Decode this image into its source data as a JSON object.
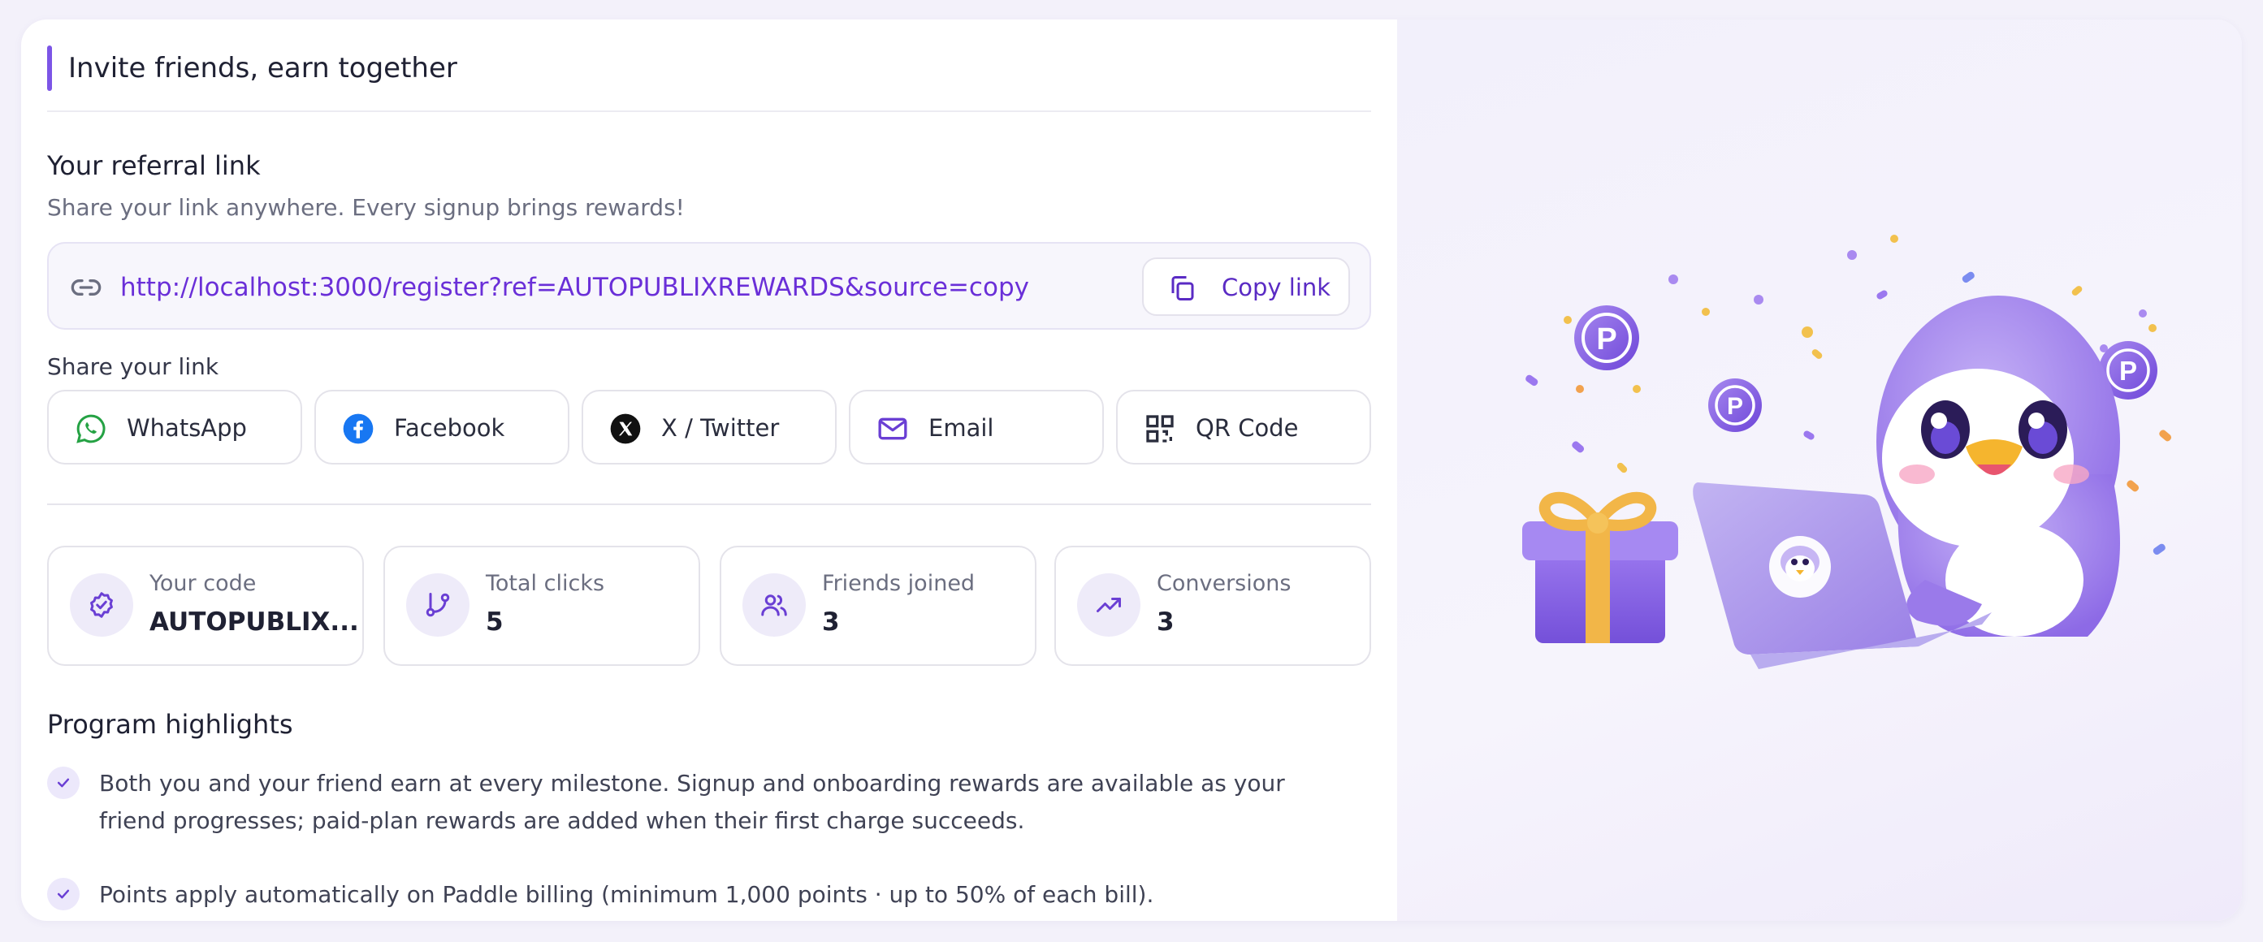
{
  "header": {
    "title": "Invite friends, earn together"
  },
  "referral": {
    "title": "Your referral link",
    "subtitle": "Share your link anywhere. Every signup brings rewards!",
    "link": "http://localhost:3000/register?ref=AUTOPUBLIXREWARDS&source=copy",
    "copy_label": "Copy link"
  },
  "share": {
    "label": "Share your link",
    "buttons": [
      {
        "label": "WhatsApp",
        "icon": "whatsapp-icon"
      },
      {
        "label": "Facebook",
        "icon": "facebook-icon"
      },
      {
        "label": "X / Twitter",
        "icon": "x-twitter-icon"
      },
      {
        "label": "Email",
        "icon": "mail-icon"
      },
      {
        "label": "QR Code",
        "icon": "qr-code-icon"
      }
    ]
  },
  "stats": [
    {
      "label": "Your code",
      "value": "AUTOPUBLIX...",
      "icon": "badge-check-icon"
    },
    {
      "label": "Total clicks",
      "value": "5",
      "icon": "git-branch-icon"
    },
    {
      "label": "Friends joined",
      "value": "3",
      "icon": "users-icon"
    },
    {
      "label": "Conversions",
      "value": "3",
      "icon": "trending-up-icon"
    }
  ],
  "highlights": {
    "title": "Program highlights",
    "items": [
      "Both you and your friend earn at every milestone. Signup and onboarding rewards are available as your friend progresses; paid-plan rewards are added when their first charge succeeds.",
      "Points apply automatically on Paddle billing (minimum 1,000 points · up to 50% of each bill)."
    ]
  },
  "illustration": {
    "coin_letter": "P"
  },
  "colors": {
    "accent": "#7c55e6",
    "link": "#6a2fd8",
    "whatsapp": "#25a244",
    "facebook": "#1877f2"
  }
}
